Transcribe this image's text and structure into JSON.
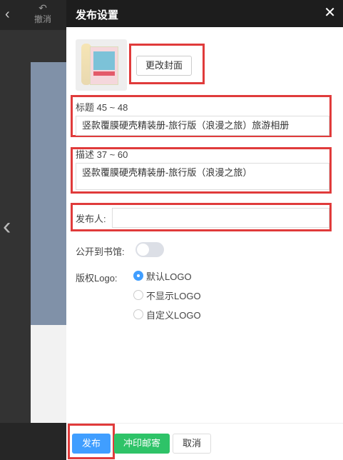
{
  "topbar": {
    "undo_label": "撤消"
  },
  "panel": {
    "title": "发布设置",
    "change_cover_label": "更改封面",
    "title_field": {
      "label": "标题 45 ~ 48",
      "value": "竖款覆膜硬壳精装册-旅行版（浪漫之旅）旅游相册"
    },
    "desc_field": {
      "label": "描述 37 ~ 60",
      "value": "竖款覆膜硬壳精装册-旅行版（浪漫之旅）"
    },
    "publisher_field": {
      "label": "发布人:",
      "value": ""
    },
    "public_library": {
      "label": "公开到书馆:",
      "enabled": false
    },
    "copyright_logo": {
      "label": "版权Logo:",
      "options": [
        {
          "label": "默认LOGO",
          "checked": true
        },
        {
          "label": "不显示LOGO",
          "checked": false
        },
        {
          "label": "自定义LOGO",
          "checked": false
        }
      ]
    }
  },
  "footer": {
    "publish_label": "发布",
    "print_label": "冲印邮寄",
    "cancel_label": "取消"
  },
  "colors": {
    "header_bg": "#1d1d1d",
    "primary": "#409eff",
    "success": "#2ec368",
    "highlight_box": "#e03b3b"
  }
}
